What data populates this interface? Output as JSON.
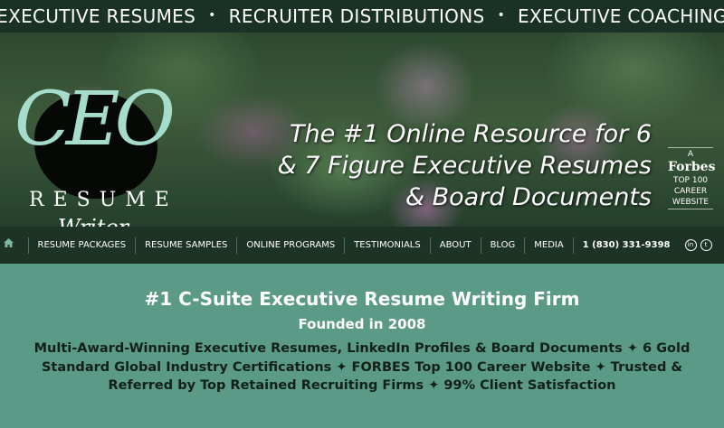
{
  "top_bar": {
    "items": [
      "EXECUTIVE RESUMES",
      "RECRUITER DISTRIBUTIONS",
      "EXECUTIVE COACHING"
    ],
    "separator": "•"
  },
  "logo": {
    "ceo": "CEO",
    "resume": "RESUME",
    "writer": "Writer"
  },
  "hero": {
    "headline": "The #1 Online Resource for 6 & 7 Figure Executive Resumes & Board Documents"
  },
  "forbes_badge": {
    "line1": "A",
    "brand": "Forbes",
    "line3": "TOP 100",
    "line4": "CAREER",
    "line5": "WEBSITE"
  },
  "nav": {
    "home_icon": "home-icon",
    "items": [
      "RESUME PACKAGES",
      "RESUME SAMPLES",
      "ONLINE PROGRAMS",
      "TESTIMONIALS",
      "ABOUT",
      "BLOG",
      "MEDIA"
    ],
    "phone": "1 (830) 331-9398",
    "social": [
      {
        "icon": "linkedin-icon",
        "glyph": "in"
      },
      {
        "icon": "twitter-icon",
        "glyph": "t"
      }
    ]
  },
  "main": {
    "title": "#1 C-Suite Executive Resume Writing Firm",
    "subtitle": "Founded in 2008",
    "description": "Multi-Award-Winning Executive Resumes, LinkedIn Profiles & Board Documents ✦ 6 Gold Standard Global Industry Certifications ✦ FORBES Top 100 Career Website ✦ Trusted & Referred by Top Retained Recruiting Firms ✦ 99% Client Satisfaction"
  },
  "colors": {
    "dark_green": "#1c3326",
    "teal": "#5b9a86",
    "logo_teal": "#a6dccb"
  }
}
